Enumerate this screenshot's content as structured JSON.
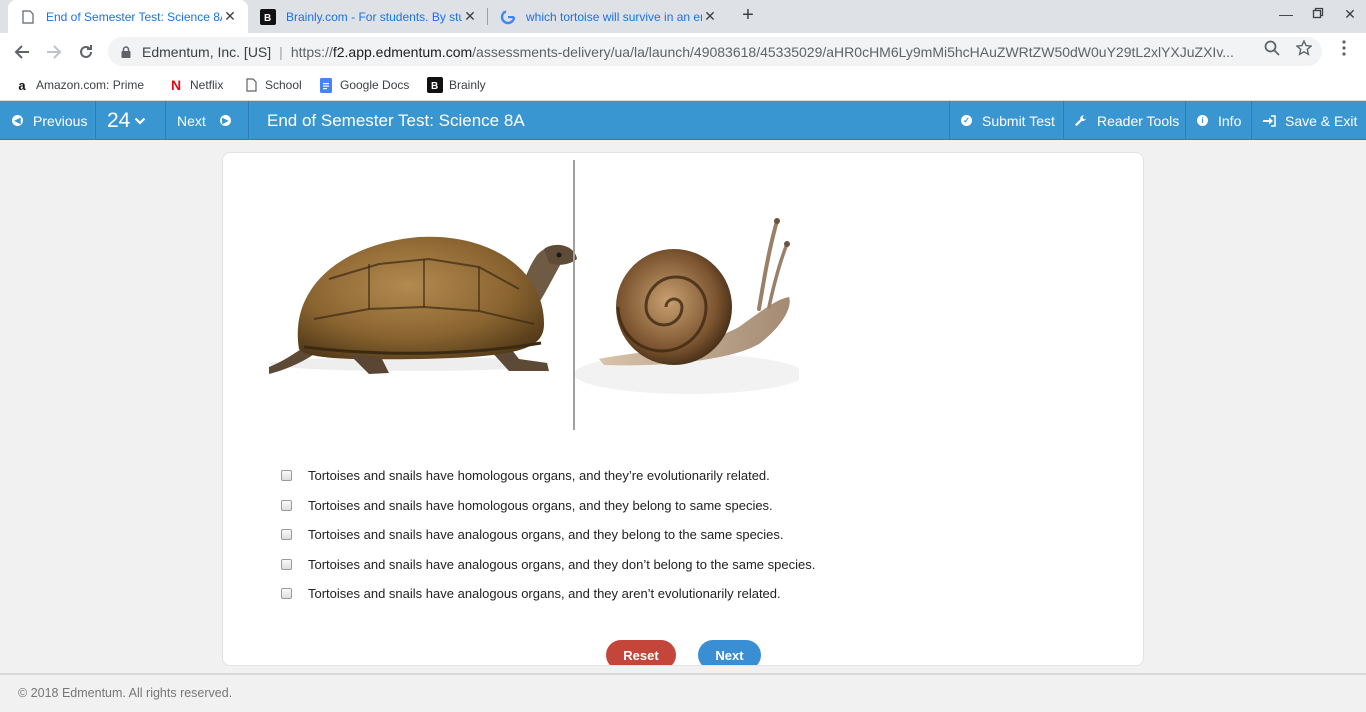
{
  "browser": {
    "tabs": [
      {
        "title": "End of Semester Test: Science 8A",
        "active": true
      },
      {
        "title": "Brainly.com - For students. By students.",
        "active": false
      },
      {
        "title": "which tortoise will survive in an environment",
        "active": false
      }
    ],
    "address": {
      "site_name": "Edmentum, Inc. [US]",
      "url_prefix": "https://",
      "url_host": "f2.app.edmentum.com",
      "url_path": "/assessments-delivery/ua/la/launch/49083618/45335029/aHR0cHM6Ly9mMi5hcHAuZWRtZW50dW0uY29tL2xlYXJuZXIv..."
    },
    "bookmarks": [
      {
        "label": "Amazon.com: Prime",
        "icon": "amazon-icon"
      },
      {
        "label": "Netflix",
        "icon": "netflix-icon"
      },
      {
        "label": "School",
        "icon": "page-icon"
      },
      {
        "label": "Google Docs",
        "icon": "docs-icon"
      },
      {
        "label": "Brainly",
        "icon": "brainly-icon"
      }
    ]
  },
  "appbar": {
    "previous": "Previous",
    "question_number": "24",
    "next": "Next",
    "test_title": "End of Semester Test: Science 8A",
    "submit": "Submit Test",
    "reader_tools": "Reader Tools",
    "info": "Info",
    "save_exit": "Save & Exit",
    "color": "#3a96d0"
  },
  "question": {
    "options": [
      "Tortoises and snails have homologous organs, and they’re evolutionarily related.",
      "Tortoises and snails have homologous organs, and they belong to same species.",
      "Tortoises and snails have analogous organs, and they belong to the same species.",
      "Tortoises and snails have analogous organs, and they don’t belong to the same species.",
      "Tortoises and snails have analogous organs, and they aren’t evolutionarily related."
    ],
    "reset_label": "Reset",
    "next_label": "Next"
  },
  "footer": {
    "copyright": "© 2018 Edmentum. All rights reserved."
  }
}
